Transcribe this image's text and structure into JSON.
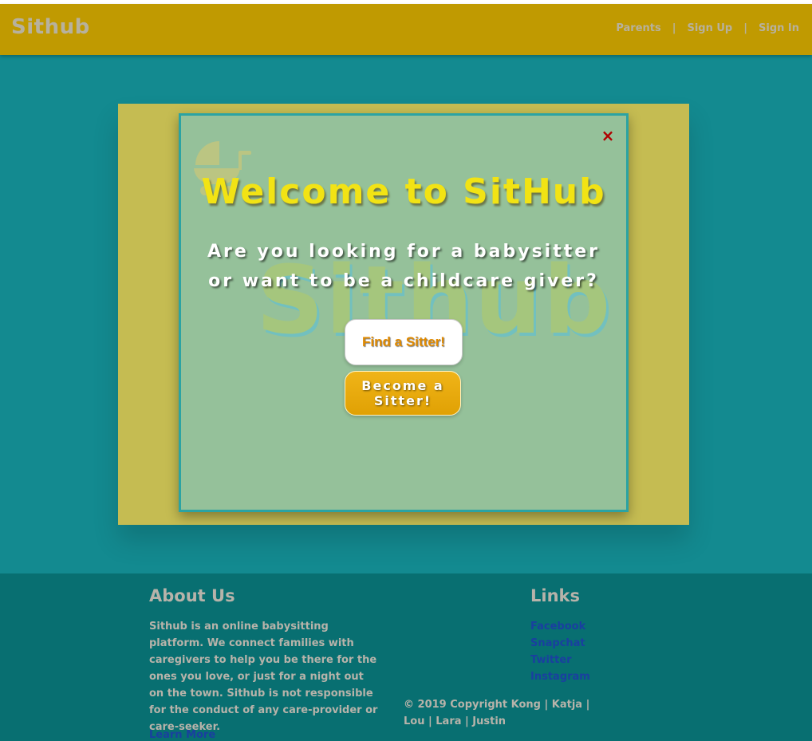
{
  "header": {
    "brand": "Sithub",
    "nav": [
      {
        "label": "Parents"
      },
      {
        "label": "Sign Up"
      },
      {
        "label": "Sign In"
      }
    ],
    "separator": "|"
  },
  "hero": {
    "background_word": "Sithub"
  },
  "modal": {
    "close_icon": "×",
    "title": "Welcome to SitHub",
    "subtitle": "Are you looking for a babysitter or want to be a childcare giver?",
    "find_button": "Find a Sitter!",
    "become_button": "Become a Sitter!"
  },
  "footer": {
    "about_heading": "About Us",
    "about_text": "Sithub is an online babysitting platform. We connect families with caregivers to help you be there for the ones you love, or just for a night out on the town. Sithub is not responsible for the conduct of any care-provider or care-seeker.",
    "learn_more": "Learn More",
    "links_heading": "Links",
    "links": [
      "Facebook",
      "Snapchat",
      "Twitter",
      "Instagram"
    ],
    "copyright": "© 2019 Copyright Kong | Katja | Lou | Lara | Justin"
  },
  "colors": {
    "page_bg": "#138a90",
    "navbar": "#c09a01",
    "hero_bg": "#c5bc52",
    "modal_bg": "#95c19a",
    "modal_border": "#2ba3a3",
    "title": "#f2e314",
    "footer": "#086f71",
    "link": "#1a3fa0",
    "close": "#b00000"
  },
  "icons": {
    "stroller": "stroller-icon",
    "close": "close-icon"
  }
}
